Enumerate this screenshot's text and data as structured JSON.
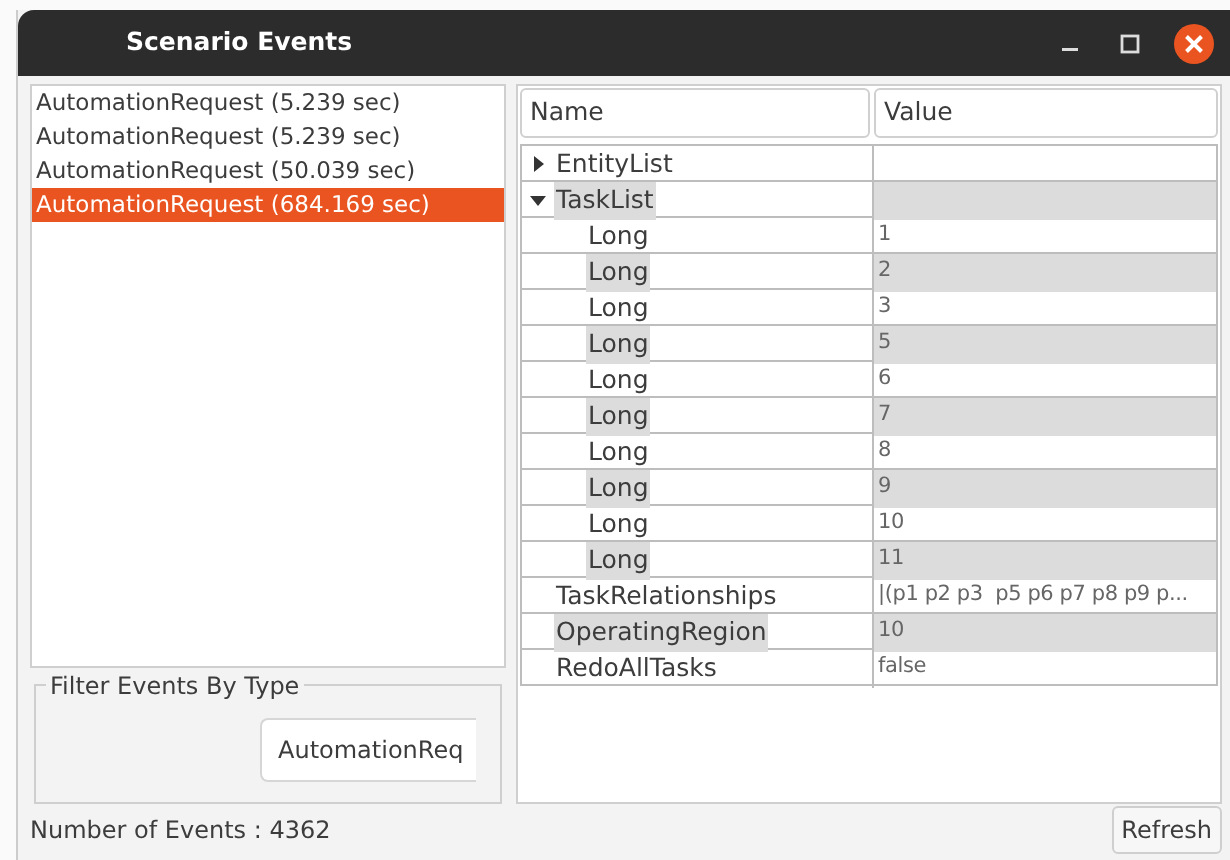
{
  "window": {
    "title": "Scenario Events"
  },
  "events": [
    {
      "label": "AutomationRequest (5.239 sec)",
      "selected": false
    },
    {
      "label": "AutomationRequest (5.239 sec)",
      "selected": false
    },
    {
      "label": "AutomationRequest (50.039 sec)",
      "selected": false
    },
    {
      "label": "AutomationRequest (684.169 sec)",
      "selected": true
    }
  ],
  "filter": {
    "title": "Filter Events By Type",
    "value": "AutomationReq"
  },
  "table": {
    "columns": [
      "Name",
      "Value"
    ],
    "rows": [
      {
        "name": "EntityList",
        "shaded": false,
        "expanded": false
      },
      {
        "name": "TaskList",
        "shaded": true,
        "expanded": true,
        "children": [
          {
            "name": "Long",
            "value": "1",
            "shaded": false
          },
          {
            "name": "Long",
            "value": "2",
            "shaded": true
          },
          {
            "name": "Long",
            "value": "3",
            "shaded": false
          },
          {
            "name": "Long",
            "value": "5",
            "shaded": true
          },
          {
            "name": "Long",
            "value": "6",
            "shaded": false
          },
          {
            "name": "Long",
            "value": "7",
            "shaded": true
          },
          {
            "name": "Long",
            "value": "8",
            "shaded": false
          },
          {
            "name": "Long",
            "value": "9",
            "shaded": true
          },
          {
            "name": "Long",
            "value": "10",
            "shaded": false
          },
          {
            "name": "Long",
            "value": "11",
            "shaded": true
          }
        ]
      },
      {
        "name": "TaskRelationships",
        "value": "|(p1 p2 p3  p5 p6 p7 p8 p9 p...",
        "shaded": false
      },
      {
        "name": "OperatingRegion",
        "value": "10",
        "shaded": true
      },
      {
        "name": "RedoAllTasks",
        "value": "false",
        "shaded": false
      }
    ]
  },
  "status": {
    "text": "Number of Events : 4362"
  },
  "buttons": [
    "Refresh"
  ]
}
